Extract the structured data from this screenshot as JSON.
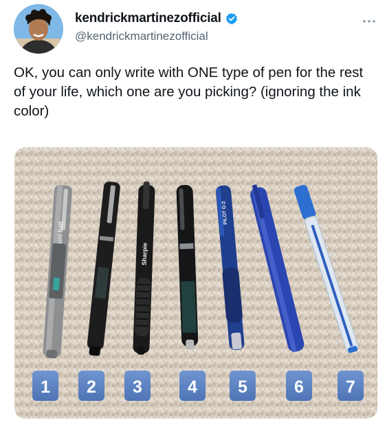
{
  "author": {
    "display_name": "kendrickmartinezofficial",
    "handle": "@kendrickmartinezofficial",
    "verified_color": "#1d9bf0",
    "avatar_icon": "avatar-photo"
  },
  "more_icon": "more-horizontal-icon",
  "tweet": {
    "text": "OK, you can only write with ONE type of pen for the rest of your life, which one are you picking? (ignoring the ink color)"
  },
  "media": {
    "description_icon": "photo",
    "pens": [
      {
        "number": "1",
        "brand": "uni-ball"
      },
      {
        "number": "2",
        "brand": ""
      },
      {
        "number": "3",
        "brand": "Sharpie"
      },
      {
        "number": "4",
        "brand": ""
      },
      {
        "number": "5",
        "brand": "PILOT G-2"
      },
      {
        "number": "6",
        "brand": ""
      },
      {
        "number": "7",
        "brand": ""
      }
    ],
    "label_color": "#5b82c4"
  }
}
